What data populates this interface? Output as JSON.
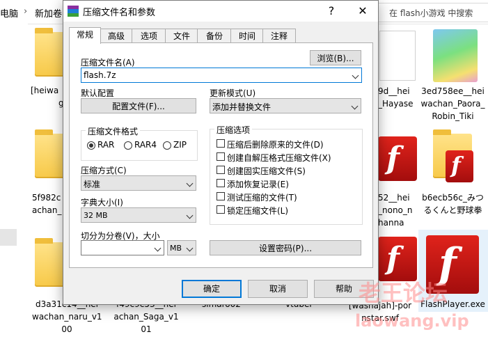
{
  "explorer": {
    "crumb_pc": "电脑",
    "crumb_folder": "新加卷",
    "search_placeholder": "在 flash小游戏 中搜索",
    "tiles": [
      {
        "caption": [
          "[heiwa",
          "g"
        ]
      },
      {
        "caption": [
          "9d__hei",
          "_Hayase"
        ]
      },
      {
        "caption": [
          "3ed758ee__hei",
          "wachan_Paora_",
          "Robin_Tiki"
        ]
      },
      {
        "caption": [
          "5f982c",
          "achan_"
        ]
      },
      {
        "caption": [
          "52__hei",
          "_nono_n",
          "hanna"
        ]
      },
      {
        "caption": [
          "b6ecb56c_みつ",
          "るくんと野球拳"
        ]
      },
      {
        "caption": [
          "d3a31c14__hei",
          "wachan_naru_v1",
          "00"
        ]
      },
      {
        "caption": [
          "f49c9c53__hei",
          "achan_Saga_v1",
          "01"
        ]
      },
      {
        "caption": [
          "simaro02"
        ]
      },
      {
        "caption": [
          "vtuber"
        ]
      },
      {
        "caption": [
          "[washajah]-por",
          "nstar.swf"
        ]
      },
      {
        "caption": [
          "FlashPlayer.exe"
        ]
      }
    ]
  },
  "dialog": {
    "title": "压缩文件名和参数",
    "help_glyph": "?",
    "close_glyph": "✕",
    "tabs": [
      "常规",
      "高级",
      "选项",
      "文件",
      "备份",
      "时间",
      "注释"
    ],
    "archive_name_label": "压缩文件名(A)",
    "browse_button": "浏览(B)...",
    "archive_name_value": "flash.7z",
    "default_profile_label": "默认配置",
    "profiles_button": "配置文件(F)...",
    "update_mode_label": "更新模式(U)",
    "update_mode_value": "添加并替换文件",
    "format_group_label": "压缩文件格式",
    "formats": [
      "RAR",
      "RAR4",
      "ZIP"
    ],
    "format_selected": "RAR",
    "options_group_label": "压缩选项",
    "options": [
      {
        "label": "压缩后删除原来的文件(D)",
        "checked": false
      },
      {
        "label": "创建自解压格式压缩文件(X)",
        "checked": false
      },
      {
        "label": "创建固实压缩文件(S)",
        "checked": false
      },
      {
        "label": "添加恢复记录(E)",
        "checked": false
      },
      {
        "label": "测试压缩的文件(T)",
        "checked": false
      },
      {
        "label": "锁定压缩文件(L)",
        "checked": false
      }
    ],
    "method_label": "压缩方式(C)",
    "method_value": "标准",
    "dict_label": "字典大小(I)",
    "dict_value": "32 MB",
    "split_label": "切分为分卷(V)，大小",
    "split_value": "",
    "split_unit": "MB",
    "password_button": "设置密码(P)...",
    "ok_button": "确定",
    "cancel_button": "取消",
    "help_button": "帮助"
  },
  "watermark": {
    "line1": "老王论坛",
    "line2": "laowang.vip"
  },
  "colors": {
    "accent": "#0078d7",
    "dialog_bg": "#f0f0f0",
    "flash_red": "#c8181a"
  }
}
